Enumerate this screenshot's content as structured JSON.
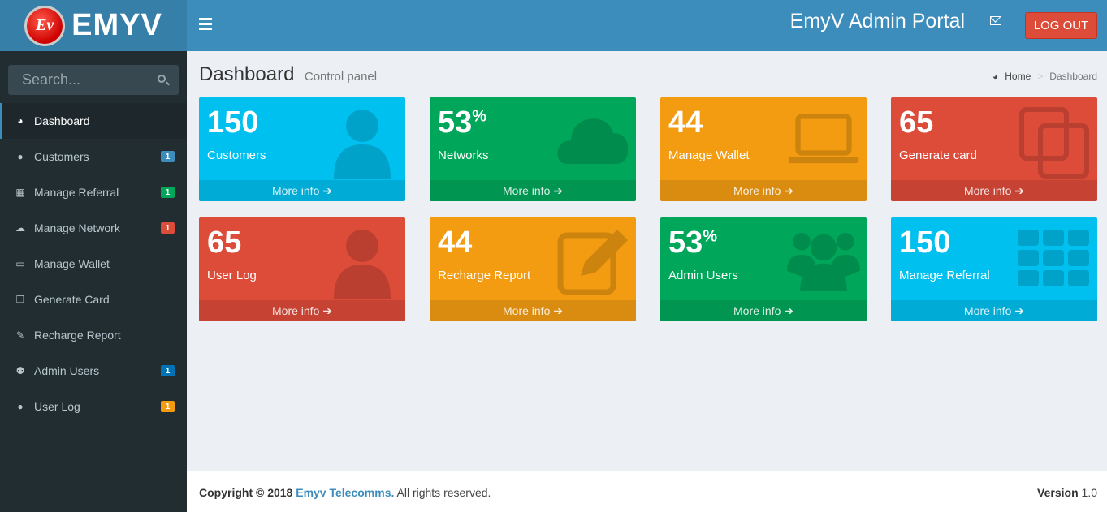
{
  "logo": {
    "badge": "Ev",
    "text": "EMYV"
  },
  "header": {
    "title": "EmyV Admin Portal",
    "logout": "LOG OUT"
  },
  "search": {
    "placeholder": "Search..."
  },
  "sidebar": {
    "items": [
      {
        "label": "Dashboard",
        "icon": "dashboard-icon"
      },
      {
        "label": "Customers",
        "icon": "user-icon",
        "badge": "1",
        "badge_color": "#3c8dbc"
      },
      {
        "label": "Manage Referral",
        "icon": "grid-icon",
        "badge": "1",
        "badge_color": "#00a65a"
      },
      {
        "label": "Manage Network",
        "icon": "cloud-icon",
        "badge": "1",
        "badge_color": "#dd4b39"
      },
      {
        "label": "Manage Wallet",
        "icon": "laptop-icon"
      },
      {
        "label": "Generate Card",
        "icon": "copy-icon"
      },
      {
        "label": "Recharge Report",
        "icon": "edit-icon"
      },
      {
        "label": "Admin Users",
        "icon": "users-icon",
        "badge": "1",
        "badge_color": "#0073b7"
      },
      {
        "label": "User Log",
        "icon": "user-icon",
        "badge": "1",
        "badge_color": "#f39c12"
      }
    ]
  },
  "page": {
    "title": "Dashboard",
    "subtitle": "Control panel"
  },
  "breadcrumb": {
    "home": "Home",
    "sep": ">",
    "current": "Dashboard"
  },
  "boxes": [
    {
      "value": "150",
      "suffix": "",
      "label": "Customers",
      "more": "More info ➔",
      "color": "#00c0ef",
      "icon": "user-icon"
    },
    {
      "value": "53",
      "suffix": "%",
      "label": "Networks",
      "more": "More info ➔",
      "color": "#00a65a",
      "icon": "cloud-icon"
    },
    {
      "value": "44",
      "suffix": "",
      "label": "Manage Wallet",
      "more": "More info ➔",
      "color": "#f39c12",
      "icon": "laptop-icon"
    },
    {
      "value": "65",
      "suffix": "",
      "label": "Generate card",
      "more": "More info ➔",
      "color": "#dd4b39",
      "icon": "copy-icon"
    },
    {
      "value": "65",
      "suffix": "",
      "label": "User Log",
      "more": "More info ➔",
      "color": "#dd4b39",
      "icon": "user-icon"
    },
    {
      "value": "44",
      "suffix": "",
      "label": "Recharge Report",
      "more": "More info ➔",
      "color": "#f39c12",
      "icon": "edit-icon"
    },
    {
      "value": "53",
      "suffix": "%",
      "label": "Admin Users",
      "more": "More info ➔",
      "color": "#00a65a",
      "icon": "users-icon"
    },
    {
      "value": "150",
      "suffix": "",
      "label": "Manage Referral",
      "more": "More info ➔",
      "color": "#00c0ef",
      "icon": "grid-icon"
    }
  ],
  "footer": {
    "copyright": "Copyright © 2018",
    "company": "Emyv Telecomms.",
    "rights": "All rights reserved.",
    "version_label": "Version",
    "version": "1.0"
  }
}
